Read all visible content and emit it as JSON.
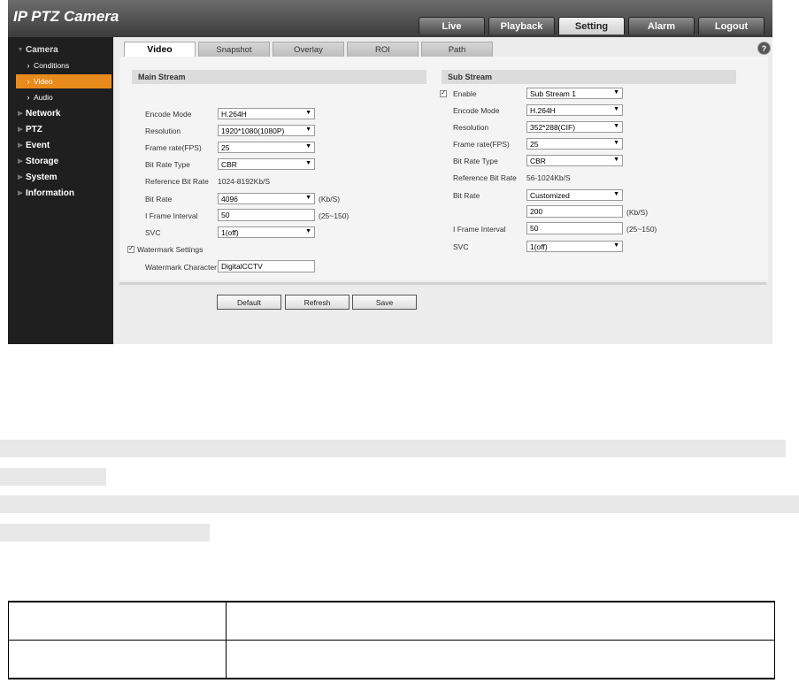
{
  "app": {
    "title": "IP PTZ Camera"
  },
  "topnav": [
    {
      "label": "Live",
      "active": false
    },
    {
      "label": "Playback",
      "active": false
    },
    {
      "label": "Setting",
      "active": true
    },
    {
      "label": "Alarm",
      "active": false
    },
    {
      "label": "Logout",
      "active": false
    }
  ],
  "sidebar": {
    "items": [
      {
        "label": "Camera",
        "level": "top",
        "open": true
      },
      {
        "label": "Conditions",
        "level": "sub"
      },
      {
        "label": "Video",
        "level": "sub",
        "active": true
      },
      {
        "label": "Audio",
        "level": "sub"
      },
      {
        "label": "Network",
        "level": "top"
      },
      {
        "label": "PTZ",
        "level": "top"
      },
      {
        "label": "Event",
        "level": "top"
      },
      {
        "label": "Storage",
        "level": "top"
      },
      {
        "label": "System",
        "level": "top"
      },
      {
        "label": "Information",
        "level": "top"
      }
    ]
  },
  "tabs": [
    {
      "label": "Video",
      "active": true
    },
    {
      "label": "Snapshot"
    },
    {
      "label": "Overlay"
    },
    {
      "label": "ROI"
    },
    {
      "label": "Path"
    }
  ],
  "help_icon": "help-icon",
  "main_stream": {
    "title": "Main Stream",
    "encode_mode": {
      "label": "Encode Mode",
      "value": "H.264H"
    },
    "resolution": {
      "label": "Resolution",
      "value": "1920*1080(1080P)"
    },
    "frame_rate": {
      "label": "Frame rate(FPS)",
      "value": "25"
    },
    "bit_rate_type": {
      "label": "Bit Rate Type",
      "value": "CBR"
    },
    "reference_bit_rate": {
      "label": "Reference Bit Rate",
      "value": "1024-8192Kb/S"
    },
    "bit_rate": {
      "label": "Bit Rate",
      "value": "4096",
      "unit": "(Kb/S)"
    },
    "i_frame_interval": {
      "label": "I Frame Interval",
      "value": "50",
      "range": "(25~150)"
    },
    "svc": {
      "label": "SVC",
      "value": "1(off)"
    },
    "watermark_settings": {
      "label": "Watermark Settings",
      "checked": true
    },
    "watermark_character": {
      "label": "Watermark Character",
      "value": "DigitalCCTV"
    }
  },
  "sub_stream": {
    "title": "Sub Stream",
    "enable": {
      "label": "Enable",
      "checked": true,
      "value": "Sub Stream 1"
    },
    "encode_mode": {
      "label": "Encode Mode",
      "value": "H.264H"
    },
    "resolution": {
      "label": "Resolution",
      "value": "352*288(CIF)"
    },
    "frame_rate": {
      "label": "Frame rate(FPS)",
      "value": "25"
    },
    "bit_rate_type": {
      "label": "Bit Rate Type",
      "value": "CBR"
    },
    "reference_bit_rate": {
      "label": "Reference Bit Rate",
      "value": "56-1024Kb/S"
    },
    "bit_rate": {
      "label": "Bit Rate",
      "value": "Customized",
      "custom_value": "200",
      "unit": "(Kb/S)"
    },
    "i_frame_interval": {
      "label": "I Frame Interval",
      "value": "50",
      "range": "(25~150)"
    },
    "svc": {
      "label": "SVC",
      "value": "1(off)"
    }
  },
  "buttons": {
    "default_label": "Default",
    "refresh_label": "Refresh",
    "save_label": "Save"
  },
  "colors": {
    "accent": "#e88b1c",
    "sidebar_bg": "#1f1f1f",
    "content_bg": "#ececec"
  }
}
